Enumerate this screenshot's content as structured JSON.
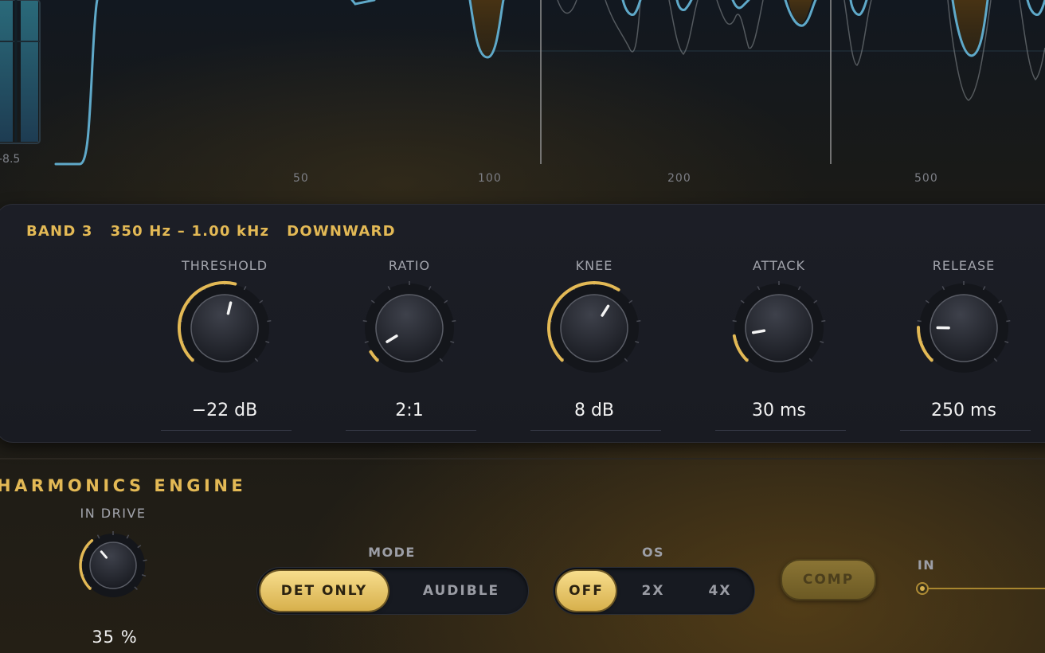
{
  "analyzer": {
    "meter_value": "-8.5",
    "freq_labels": [
      "50",
      "100",
      "200",
      "500"
    ]
  },
  "band": {
    "name": "BAND 3",
    "range": "350 Hz – 1.00 kHz",
    "mode": "DOWNWARD",
    "knobs": [
      {
        "label": "THRESHOLD",
        "value": "−22 dB",
        "level": 0.55
      },
      {
        "label": "RATIO",
        "value": "2:1",
        "level": 0.05
      },
      {
        "label": "KNEE",
        "value": "8 dB",
        "level": 0.62
      },
      {
        "label": "ATTACK",
        "value": "30 ms",
        "level": 0.13
      },
      {
        "label": "RELEASE",
        "value": "250 ms",
        "level": 0.17
      }
    ]
  },
  "harmonics": {
    "title": "HARMONICS ENGINE",
    "drive_label": "IN DRIVE",
    "drive_value": "35 %",
    "drive_level": 0.35,
    "mode_label": "MODE",
    "mode_options": [
      "DET ONLY",
      "AUDIBLE"
    ],
    "mode_selected": "DET ONLY",
    "os_label": "OS",
    "os_options": [
      "OFF",
      "2X",
      "4X"
    ],
    "os_selected": "OFF",
    "comp_label": "COMP",
    "in_label": "IN"
  },
  "colors": {
    "accent": "#e3b955",
    "curve": "#5fa9c9"
  }
}
